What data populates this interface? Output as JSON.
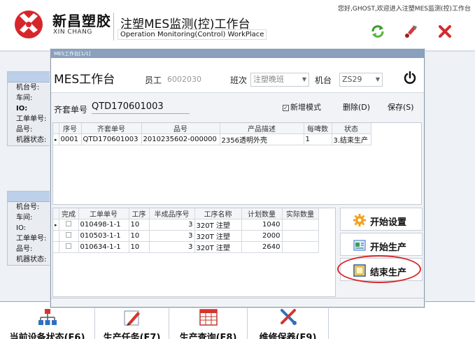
{
  "header": {
    "brand_cn": "新昌塑胶",
    "brand_en": "XIN CHANG",
    "title_cn": "注塑MES监测(控)工作台",
    "title_en": "Operation Monitoring(Control) WorkPlace",
    "welcome": "您好,GHOST,欢迎进入注塑MES监测(控)工作台",
    "icons": [
      "refresh-icon",
      "wrench-icon",
      "close-icon"
    ]
  },
  "left_panels": [
    {
      "rows": [
        "机台号:",
        "车间:",
        "IO:",
        "工单单号:",
        "品号:",
        "机器状态:"
      ]
    },
    {
      "rows": [
        "机台号:",
        "车间:",
        "IO:",
        "工单单号:",
        "品号:",
        "机器状态:"
      ]
    }
  ],
  "modal": {
    "titlebar": "MES工作台[1/1]",
    "title": "MES工作台",
    "employee_label": "员工",
    "employee_value": "6002030",
    "shift_label": "班次",
    "shift_value": "注塑晚班",
    "machine_label": "机台",
    "machine_value": "ZS29",
    "order_label": "齐套单号",
    "order_value": "QTD170601003",
    "new_mode_label": "新增模式",
    "new_mode_checked": true,
    "delete_label": "删除(D)",
    "save_label": "保存(S)",
    "upper_grid": {
      "headers": [
        "序号",
        "齐套单号",
        "品号",
        "产品描述",
        "每啤数",
        "状态"
      ],
      "rows": [
        [
          "0001",
          "QTD170601003",
          "2010235602-000000",
          "2356透明外壳",
          "1",
          "3.结束生产"
        ]
      ]
    },
    "lower_grid": {
      "headers": [
        "完成",
        "工单单号",
        "工序",
        "半成品序号",
        "工序名称",
        "计划数量",
        "实际数量"
      ],
      "rows": [
        [
          "",
          "010498-1-1",
          "10",
          "3",
          "320T 注塑",
          "1040",
          ""
        ],
        [
          "",
          "010503-1-1",
          "10",
          "3",
          "320T 注塑",
          "2000",
          ""
        ],
        [
          "",
          "010634-1-1",
          "10",
          "3",
          "320T 注塑",
          "2640",
          ""
        ]
      ]
    },
    "actions": [
      {
        "label": "开始设置",
        "icon": "gear-icon"
      },
      {
        "label": "开始生产",
        "icon": "start-production-icon"
      },
      {
        "label": "结束生产",
        "icon": "stop-icon",
        "highlighted": true
      }
    ]
  },
  "bottom_nav": [
    {
      "label": "当前设备状态(F6)",
      "icon": "network-icon"
    },
    {
      "label": "生产任务(F7)",
      "icon": "pencil-icon"
    },
    {
      "label": "生产查询(F8)",
      "icon": "table-icon"
    },
    {
      "label": "维修保养(F9)",
      "icon": "tools-icon"
    }
  ],
  "colors": {
    "highlight": "#d9262c",
    "brand_red": "#d6262b",
    "panel_header": "#bcd0ea"
  }
}
